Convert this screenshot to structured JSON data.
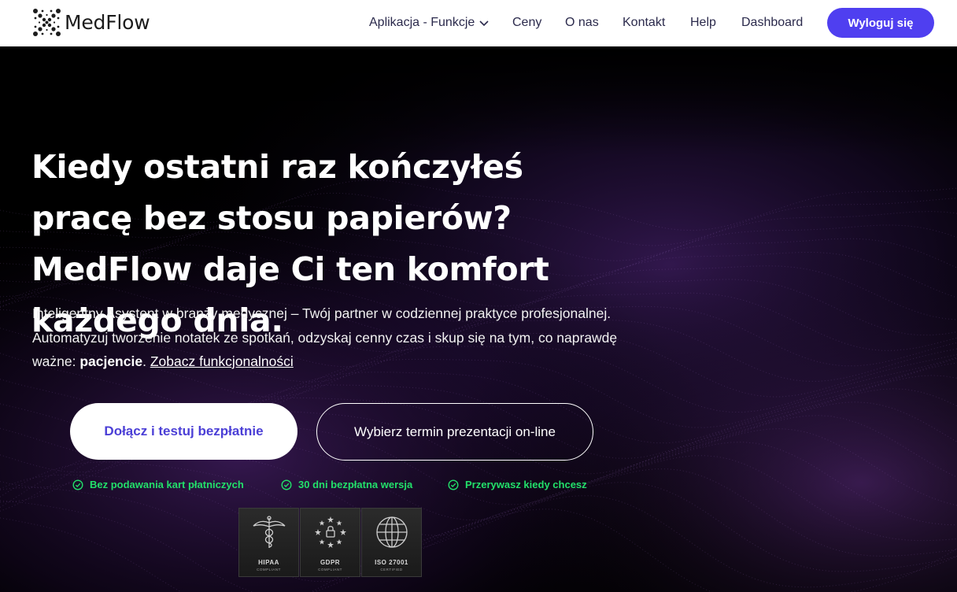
{
  "brand": {
    "name": "MedFlow"
  },
  "nav": {
    "items": [
      {
        "label": "Aplikacja - Funkcje",
        "has_dropdown": true
      },
      {
        "label": "Ceny"
      },
      {
        "label": "O nas"
      },
      {
        "label": "Kontakt"
      },
      {
        "label": "Help"
      },
      {
        "label": "Dashboard"
      }
    ],
    "logout_label": "Wyloguj się"
  },
  "hero": {
    "headline": "Kiedy ostatni raz kończyłeś pracę bez stosu papierów? MedFlow daje Ci ten komfort każdego dnia.",
    "desc_text": "Inteligentny Asystent w branży medycznej – Twój partner w codziennej praktyce profesjonalnej. Automatyzuj tworzenie notatek ze spotkań, odzyskaj cenny czas i skup się na tym, co naprawdę ważne: ",
    "desc_bold": "pacjencie",
    "desc_after": ". ",
    "desc_link": "Zobacz funkcjonalności",
    "cta_primary": "Dołącz i testuj bezpłatnie",
    "cta_secondary": "Wybierz termin prezentacji on-line",
    "features": [
      "Bez podawania kart płatniczych",
      "30 dni bezpłatna wersja",
      "Przerywasz kiedy chcesz"
    ],
    "badges": [
      {
        "title": "HIPAA",
        "subtitle": "COMPLIANT",
        "icon": "caduceus-icon"
      },
      {
        "title": "GDPR",
        "subtitle": "COMPLIANT",
        "icon": "eu-lock-icon"
      },
      {
        "title": "ISO 27001",
        "subtitle": "CERTIFIED",
        "icon": "globe-icon"
      }
    ]
  },
  "colors": {
    "accent": "#4f3ff0",
    "feature_green": "#22e06a",
    "background": "#000000"
  }
}
